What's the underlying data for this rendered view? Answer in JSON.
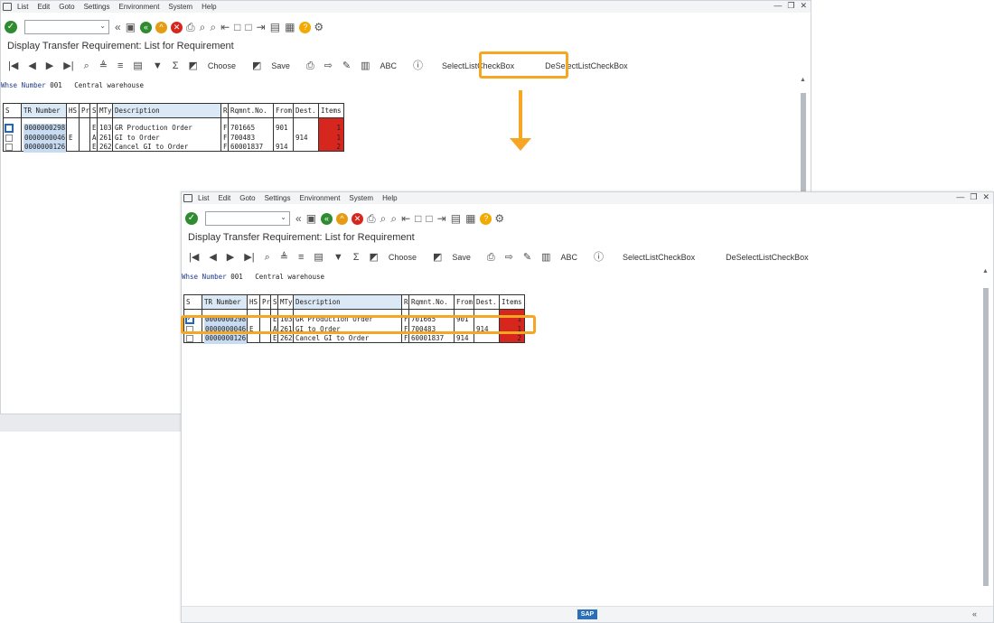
{
  "menu": [
    "List",
    "Edit",
    "Goto",
    "Settings",
    "System",
    "Help"
  ],
  "menu2": [
    "List",
    "Edit",
    "Goto",
    "Settings",
    "Environment",
    "System",
    "Help"
  ],
  "menu_full": [
    "List",
    "Edit",
    "Goto",
    "Settings",
    "Environment",
    "System",
    "Help"
  ],
  "page_title": "Display Transfer Requirement: List for Requirement",
  "toolbar": {
    "choose": "Choose",
    "save": "Save",
    "abc": "ABC",
    "select_all": "SelectListCheckBox",
    "deselect_all": "DeSelectListCheckBox"
  },
  "whse": {
    "label": "Whse Number",
    "number": "001",
    "name": "Central warehouse"
  },
  "columns": [
    "S",
    "TR Number",
    "HS",
    "Pr",
    "S",
    "MTy",
    "Description",
    "R",
    "Rqmnt.No.",
    "From",
    "Dest.",
    "Items"
  ],
  "rows_before": [
    {
      "tr": "0000000298",
      "hs": "",
      "pr": "",
      "s": "E",
      "mty": "103",
      "desc": "GR Production Order",
      "r": "F",
      "rqmnt": "701665",
      "from": "901",
      "dest": "",
      "items": "1",
      "checked": false
    },
    {
      "tr": "0000000046",
      "hs": "E",
      "pr": "",
      "s": "A",
      "mty": "261",
      "desc": "GI to Order",
      "r": "F",
      "rqmnt": "700483",
      "from": "",
      "dest": "914",
      "items": "1",
      "checked": false
    },
    {
      "tr": "0000000126",
      "hs": "",
      "pr": "",
      "s": "E",
      "mty": "262",
      "desc": "Cancel GI to Order",
      "r": "F",
      "rqmnt": "60001837",
      "from": "914",
      "dest": "",
      "items": "2",
      "checked": false
    }
  ],
  "rows_after": [
    {
      "tr": "0000000298",
      "hs": "",
      "pr": "",
      "s": "E",
      "mty": "103",
      "desc": "GR Production Order",
      "r": "F",
      "rqmnt": "701665",
      "from": "901",
      "dest": "",
      "items": "1",
      "checked": true
    },
    {
      "tr": "0000000046",
      "hs": "E",
      "pr": "",
      "s": "A",
      "mty": "261",
      "desc": "GI to Order",
      "r": "F",
      "rqmnt": "700483",
      "from": "",
      "dest": "914",
      "items": "1",
      "checked": false
    },
    {
      "tr": "0000000126",
      "hs": "",
      "pr": "",
      "s": "E",
      "mty": "262",
      "desc": "Cancel GI to Order",
      "r": "F",
      "rqmnt": "60001837",
      "from": "914",
      "dest": "",
      "items": "2",
      "checked": false
    }
  ],
  "sap_logo": "SAP",
  "colors": {
    "annotation": "#f5a623",
    "highlight": "#c7dbf2"
  }
}
